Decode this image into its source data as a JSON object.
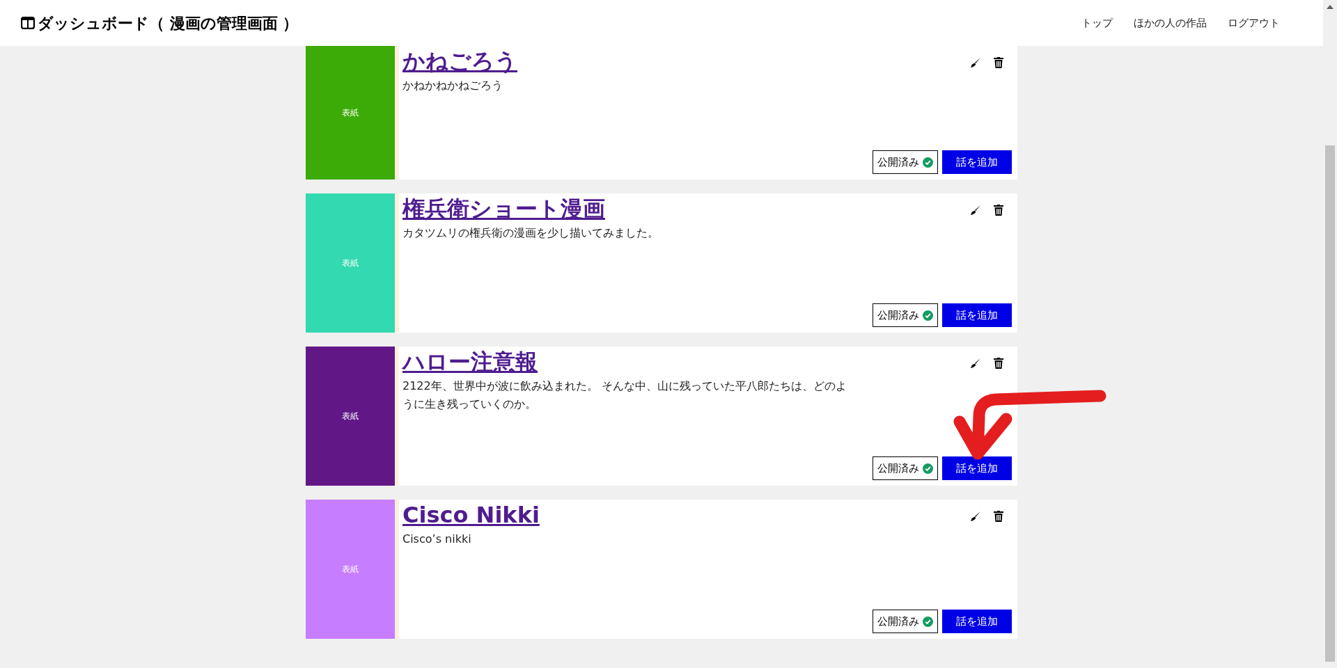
{
  "header": {
    "title": "ダッシュボード（ 漫画の管理画面 ）",
    "nav": [
      "トップ",
      "ほかの人の作品",
      "ログアウト"
    ]
  },
  "comics": [
    {
      "cover_label": "表紙",
      "color": "#3dab07",
      "title": "かねごろう",
      "description": "かねかねかねごろう",
      "status": "公開済み",
      "published": true,
      "add_button": "話を追加"
    },
    {
      "cover_label": "表紙",
      "color": "#33d9b0",
      "title": "権兵衛ショート漫画",
      "description": "カタツムリの権兵衛の漫画を少し描いてみました。",
      "status": "公開済み",
      "published": true,
      "add_button": "話を追加"
    },
    {
      "cover_label": "表紙",
      "color": "#621787",
      "title": "ハロー注意報",
      "description": "2122年、世界中が波に飲み込まれた。 そんな中、山に残っていた平八郎たちは、どのように生き残っていくのか。",
      "status": "公開済み",
      "published": true,
      "add_button": "話を追加"
    },
    {
      "cover_label": "表紙",
      "color": "#c77dff",
      "title": "Cisco Nikki",
      "description": "Cisco’s nikki",
      "status": "公開済み",
      "published": true,
      "add_button": "話を追加"
    }
  ]
}
